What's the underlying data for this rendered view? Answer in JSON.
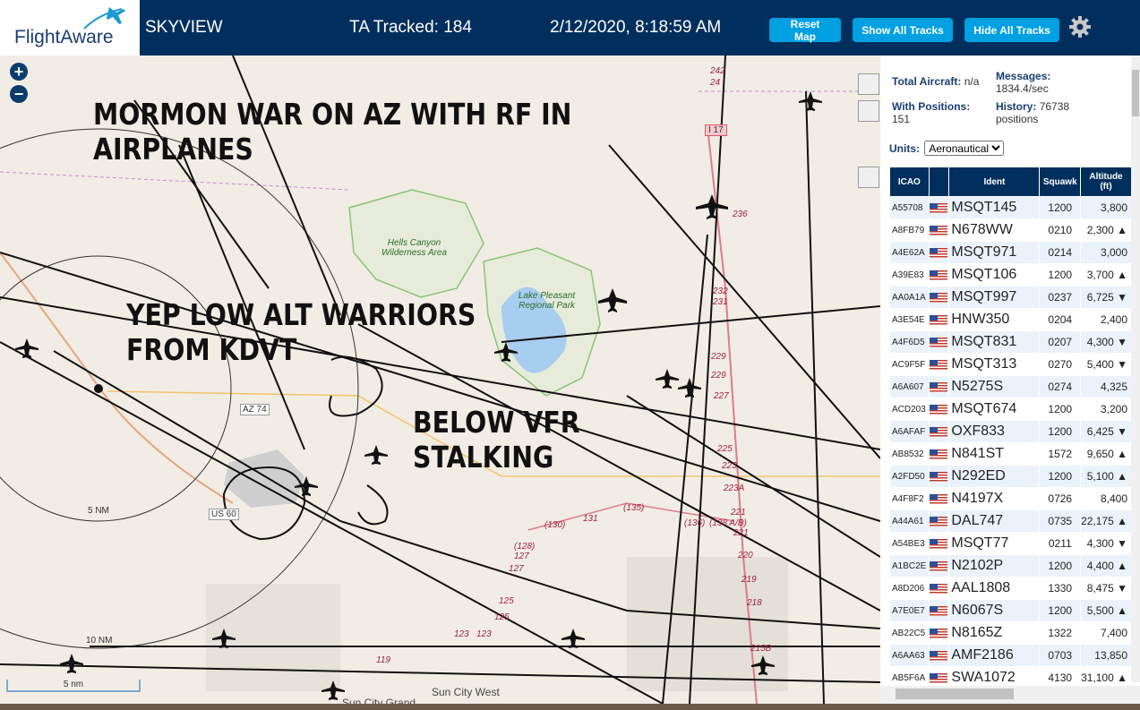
{
  "header": {
    "logo_text": "FlightAware",
    "app_title": "SKYVIEW",
    "tracked": "TA Tracked: 184",
    "clock": "2/12/2020, 8:18:59 AM",
    "buttons": {
      "reset": "Reset Map",
      "show_all": "Show All Tracks",
      "hide_all": "Hide All Tracks"
    },
    "brand_color": "#002f5d",
    "button_color": "#00a0e2"
  },
  "map": {
    "zoom_in": "+",
    "zoom_out": "−",
    "overlay_text": {
      "line1": "MORMON WAR ON AZ WITH RF IN",
      "line2": "AIRPLANES",
      "line3": "YEP LOW ALT WARRIORS",
      "line4": "FROM KDVT",
      "line5": "BELOW VFR",
      "line6": "STALKING"
    },
    "labels": {
      "hells_canyon": "Hells Canyon Wilderness Area",
      "lake_pleasant": "Lake Pleasant Regional Park",
      "az74": "AZ 74",
      "us60": "US 60",
      "i17": "I 17",
      "range_5": "5 NM",
      "range_10": "10 NM",
      "sun_city_west": "Sun City West",
      "sun_city_grand": "Sun City Grand"
    },
    "road_numbers": [
      "242",
      "24",
      "236",
      "232",
      "231",
      "229",
      "229",
      "227",
      "225",
      "223",
      "223A",
      "221",
      "221",
      "220",
      "219",
      "218",
      "215B",
      "(130)",
      "131",
      "(135)",
      "(136)",
      "(138 A/B)",
      "(128)",
      "127",
      "127",
      "125",
      "125",
      "123",
      "123",
      "119"
    ],
    "scale_label": "5 nm"
  },
  "sidebar": {
    "total_aircraft_label": "Total Aircraft:",
    "total_aircraft_value": "n/a",
    "messages_label": "Messages:",
    "messages_value": "1834.4/sec",
    "with_positions_label": "With Positions:",
    "with_positions_value": "151",
    "history_label": "History:",
    "history_value": "76738 positions",
    "units_label": "Units:",
    "units_value": "Aeronautical",
    "columns": [
      "ICAO",
      "",
      "Ident",
      "Squawk",
      "Altitude (ft)"
    ],
    "rows": [
      {
        "icao": "A55708",
        "ident": "MSQT145",
        "squawk": "1200",
        "alt": "3,800"
      },
      {
        "icao": "A8FB79",
        "ident": "N678WW",
        "squawk": "0210",
        "alt": "2,300 ▲"
      },
      {
        "icao": "A4E62A",
        "ident": "MSQT971",
        "squawk": "0214",
        "alt": "3,000"
      },
      {
        "icao": "A39E83",
        "ident": "MSQT106",
        "squawk": "1200",
        "alt": "3,700 ▲"
      },
      {
        "icao": "AA0A1A",
        "ident": "MSQT997",
        "squawk": "0237",
        "alt": "6,725 ▼"
      },
      {
        "icao": "A3E54E",
        "ident": "HNW350",
        "squawk": "0204",
        "alt": "2,400"
      },
      {
        "icao": "A4F6D5",
        "ident": "MSQT831",
        "squawk": "0207",
        "alt": "4,300 ▼"
      },
      {
        "icao": "AC9F5F",
        "ident": "MSQT313",
        "squawk": "0270",
        "alt": "5,400 ▼"
      },
      {
        "icao": "A6A607",
        "ident": "N5275S",
        "squawk": "0274",
        "alt": "4,325"
      },
      {
        "icao": "ACD203",
        "ident": "MSQT674",
        "squawk": "1200",
        "alt": "3,200"
      },
      {
        "icao": "A6AFAF",
        "ident": "OXF833",
        "squawk": "1200",
        "alt": "6,425 ▼"
      },
      {
        "icao": "AB8532",
        "ident": "N841ST",
        "squawk": "1572",
        "alt": "9,650 ▲"
      },
      {
        "icao": "A2FD50",
        "ident": "N292ED",
        "squawk": "1200",
        "alt": "5,100 ▲"
      },
      {
        "icao": "A4F8F2",
        "ident": "N4197X",
        "squawk": "0726",
        "alt": "8,400"
      },
      {
        "icao": "A44A61",
        "ident": "DAL747",
        "squawk": "0735",
        "alt": "22,175 ▲"
      },
      {
        "icao": "A54BE3",
        "ident": "MSQT77",
        "squawk": "0211",
        "alt": "4,300 ▼"
      },
      {
        "icao": "A1BC2E",
        "ident": "N2102P",
        "squawk": "1200",
        "alt": "4,400 ▲"
      },
      {
        "icao": "A8D206",
        "ident": "AAL1808",
        "squawk": "1330",
        "alt": "8,475 ▼"
      },
      {
        "icao": "A7E0E7",
        "ident": "N6067S",
        "squawk": "1200",
        "alt": "5,500 ▲"
      },
      {
        "icao": "AB22C5",
        "ident": "N8165Z",
        "squawk": "1322",
        "alt": "7,400"
      },
      {
        "icao": "A6AA63",
        "ident": "AMF2186",
        "squawk": "0703",
        "alt": "13,850"
      },
      {
        "icao": "AB5F6A",
        "ident": "SWA1072",
        "squawk": "4130",
        "alt": "31,100 ▲"
      }
    ]
  }
}
